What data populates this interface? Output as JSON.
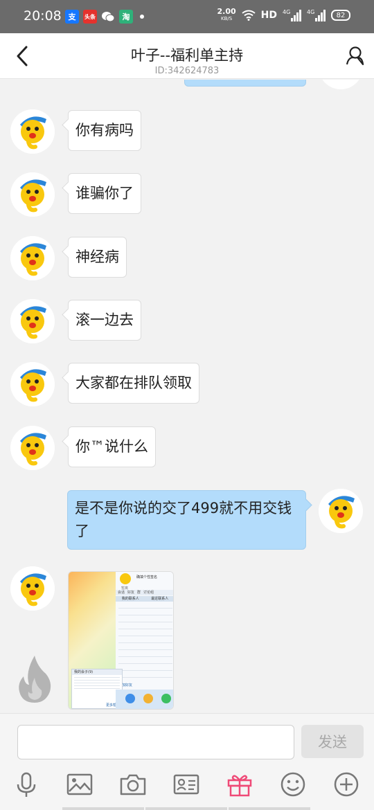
{
  "status_bar": {
    "time": "20:08",
    "network_speed_value": "2.00",
    "network_speed_unit": "KB/S",
    "hd_label": "HD",
    "signal_1": "4G",
    "signal_2": "4G",
    "battery": "82",
    "app_icons": [
      {
        "name": "alipay-icon",
        "glyph": "支",
        "color": "#1677ff"
      },
      {
        "name": "toutiao-icon",
        "glyph": "头条",
        "color": "#e5322d"
      },
      {
        "name": "wechat-icon",
        "glyph": "",
        "color": "#6b6b6b"
      },
      {
        "name": "market-icon",
        "glyph": "淘",
        "color": "#2fb17a"
      }
    ]
  },
  "header": {
    "title": "叶子--福利单主持",
    "subtitle": "ID:342624783",
    "back_icon": "back-chevron-icon",
    "profile_icon": "person-icon"
  },
  "messages": [
    {
      "direction": "in",
      "text": "你有病吗"
    },
    {
      "direction": "in",
      "text": "谁骗你了"
    },
    {
      "direction": "in",
      "text": "神经病"
    },
    {
      "direction": "in",
      "text": "滚一边去"
    },
    {
      "direction": "in",
      "text": "大家都在排队领取"
    },
    {
      "direction": "in",
      "text": "你™说什么"
    },
    {
      "direction": "out",
      "text": "是不是你说的交了499就不用交钱了"
    }
  ],
  "image_message": {
    "top_status": "暂离",
    "top_title": "确填个性签名",
    "tabs": [
      "会话",
      "好友",
      "群",
      "讨论组"
    ],
    "tab_rows": [
      "我的联系人",
      "最近联系人"
    ],
    "popup_title": "我的会子(9)",
    "footer_link": "更多帮助",
    "bottom_label": "添加好友"
  },
  "composer": {
    "input_value": "",
    "send_label": "发送"
  },
  "toolbar": {
    "icons": [
      "microphone-icon",
      "image-icon",
      "camera-icon",
      "contact-card-icon",
      "gift-icon",
      "emoji-icon",
      "plus-icon"
    ]
  },
  "colors": {
    "incoming_bubble": "#ffffff",
    "outgoing_bubble": "#b3dcfb",
    "gift_accent": "#ef4a77",
    "status_bar_bg": "#6b6b6b"
  }
}
